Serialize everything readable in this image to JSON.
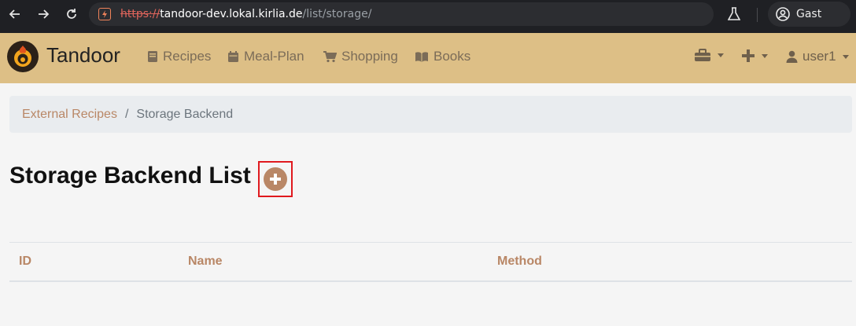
{
  "browser": {
    "url_scheme": "https://",
    "url_host": "tandoor-dev.lokal.kirlia.de",
    "url_path": "/list/storage/",
    "profile_label": "Gast"
  },
  "navbar": {
    "brand": "Tandoor",
    "links": [
      {
        "label": "Recipes",
        "icon": "book-icon"
      },
      {
        "label": "Meal-Plan",
        "icon": "calendar-icon"
      },
      {
        "label": "Shopping",
        "icon": "cart-icon"
      },
      {
        "label": "Books",
        "icon": "open-book-icon"
      }
    ],
    "user_label": "user1"
  },
  "breadcrumb": {
    "parent": "External Recipes",
    "separator": "/",
    "current": "Storage Backend"
  },
  "page": {
    "title": "Storage Backend List"
  },
  "table": {
    "headers": [
      "ID",
      "Name",
      "Method"
    ],
    "rows": []
  },
  "colors": {
    "navbar_bg": "#ddbf86",
    "accent": "#b98766",
    "highlight_border": "#e0191e"
  }
}
